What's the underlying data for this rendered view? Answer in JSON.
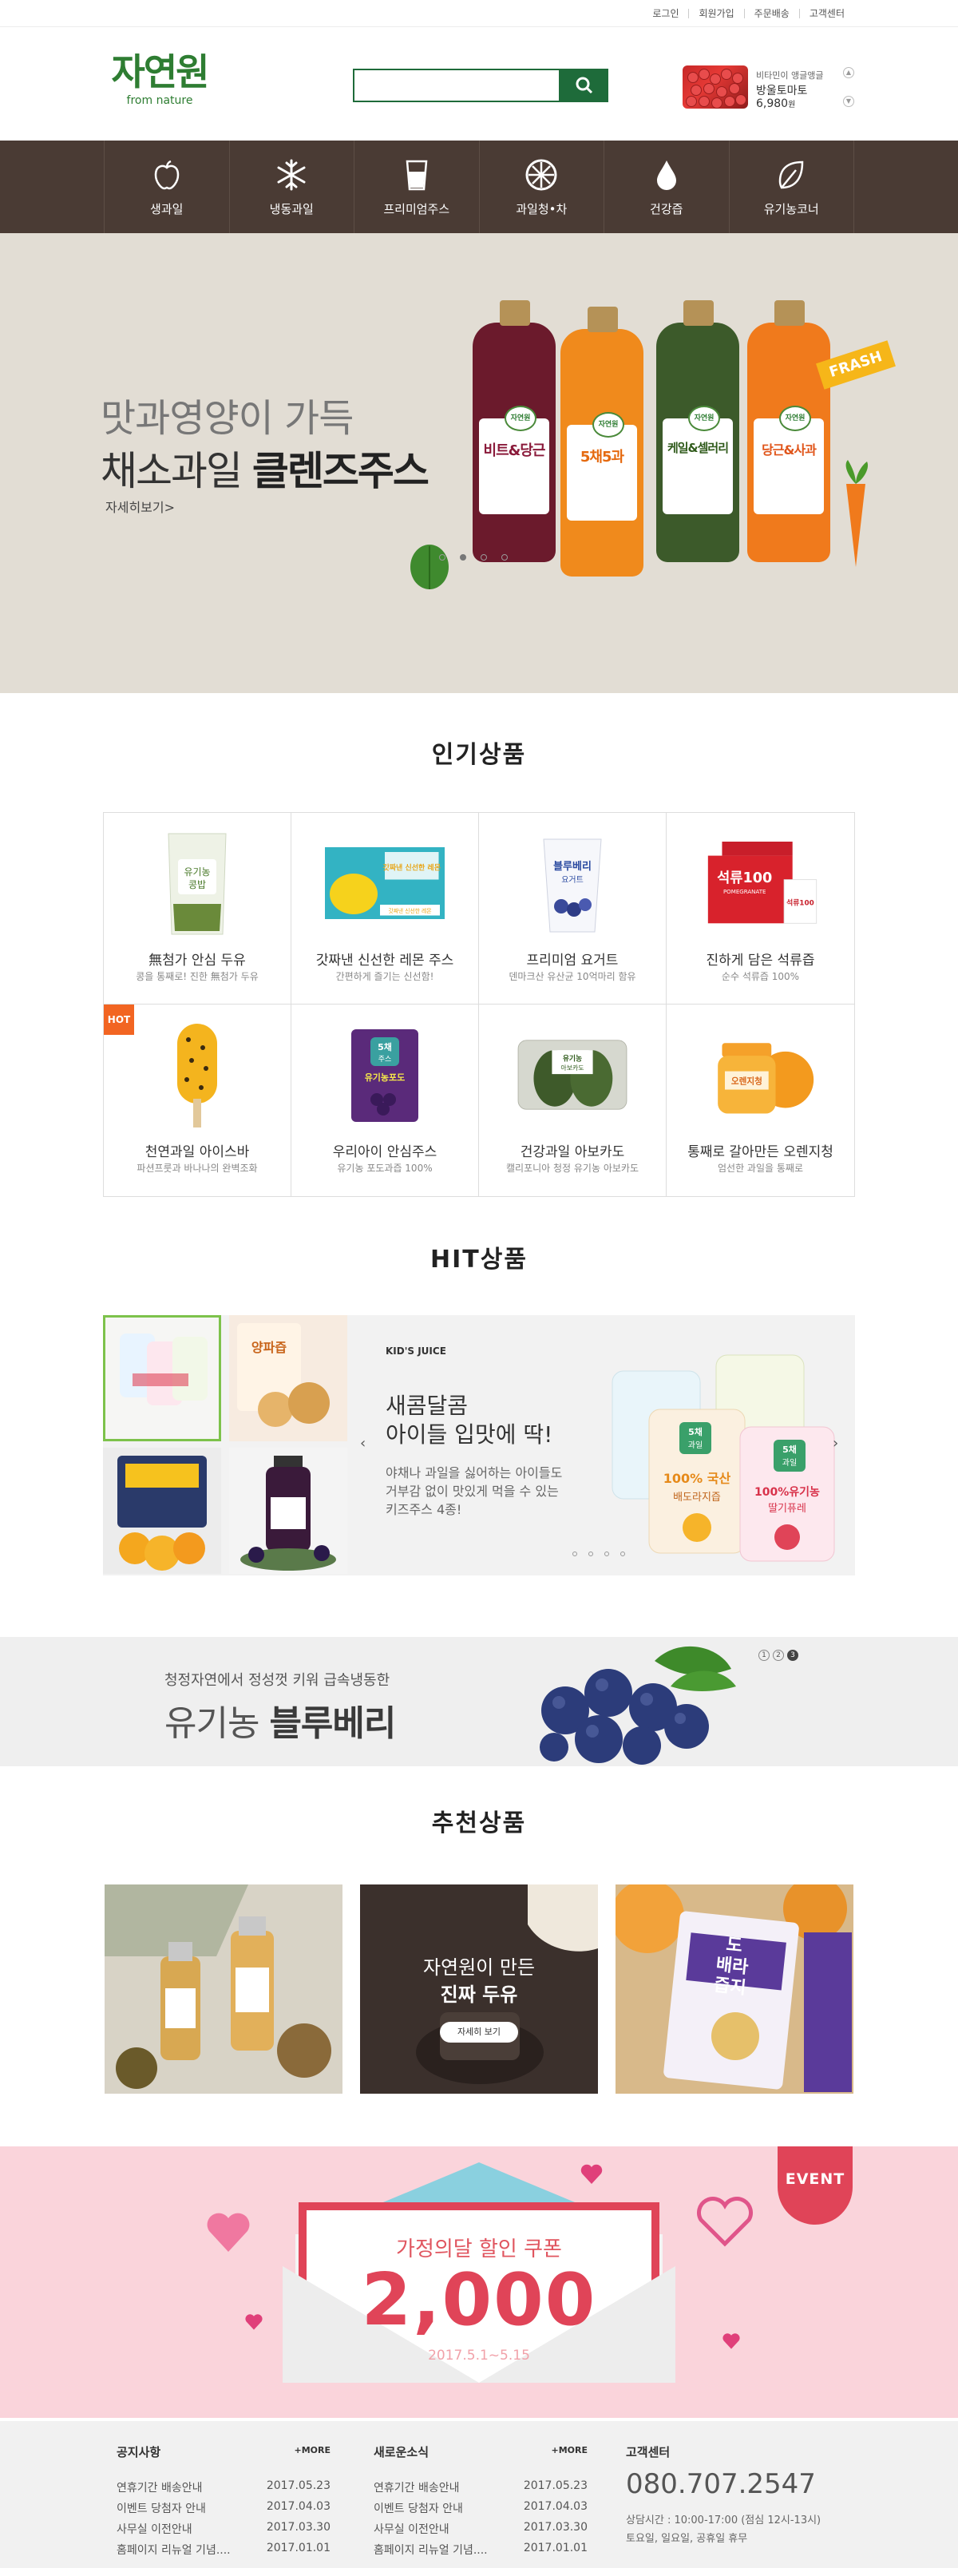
{
  "topbar": {
    "links": [
      "로그인",
      "회원가입",
      "주문배송",
      "고객센터"
    ]
  },
  "header": {
    "logo_ko": "자연원",
    "logo_en": "from nature",
    "search": {
      "value": "",
      "placeholder": ""
    },
    "promo": {
      "sub": "비타민이 앵글앵글",
      "name": "방울토마토",
      "price": "6,980",
      "unit": "원"
    }
  },
  "nav": [
    {
      "label": "생과일",
      "icon": "apple-icon"
    },
    {
      "label": "냉동과일",
      "icon": "snowflake-icon"
    },
    {
      "label": "프리미엄주스",
      "icon": "glass-icon"
    },
    {
      "label": "과일청•차",
      "icon": "citrus-slice-icon"
    },
    {
      "label": "건강즙",
      "icon": "drop-icon"
    },
    {
      "label": "유기농코너",
      "icon": "leaf-icon"
    }
  ],
  "hero": {
    "line1": "맛과영양이 가득",
    "line2_normal": "채소과일 ",
    "line2_bold": "클렌즈주스",
    "more": "자세히보기>",
    "badge": "FRASH",
    "bottles": [
      {
        "brand": "자연원",
        "name": "비트&당근",
        "color": "#6b1a2c"
      },
      {
        "brand": "자연원",
        "name": "5채5과",
        "color": "#f08a1c"
      },
      {
        "brand": "자연원",
        "name": "케일&셀러리",
        "color": "#3c5a2a"
      },
      {
        "brand": "자연원",
        "name": "당근&사과",
        "color": "#f07a1c"
      }
    ],
    "slides": 4,
    "active_slide": 2
  },
  "popular": {
    "title": "인기상품",
    "items": [
      {
        "name": "無첨가 안심 두유",
        "desc": "콩을 통째로! 진한 無첨가 두유",
        "badge": ""
      },
      {
        "name": "갓짜낸 신선한 레몬 주스",
        "desc": "간편하게 즐기는 신선함!",
        "badge": ""
      },
      {
        "name": "프리미엄 요거트",
        "desc": "덴마크산 유산균 10억마리 함유",
        "badge": ""
      },
      {
        "name": "진하게 담은 석류즙",
        "desc": "순수 석류즙 100%",
        "badge": ""
      },
      {
        "name": "천연과일 아이스바",
        "desc": "파션프룻과 바나나의 완벽조화",
        "badge": "HOT"
      },
      {
        "name": "우리아이 안심주스",
        "desc": "유기농 포도과즙 100%",
        "badge": ""
      },
      {
        "name": "건강과일 아보카도",
        "desc": "캘리포니아 청정 유기농 아보카도",
        "badge": ""
      },
      {
        "name": "통째로 갈아만든 오렌지청",
        "desc": "엄선한 과일을 통째로",
        "badge": ""
      }
    ],
    "labels": {
      "soy": [
        "유기농",
        "콩밥"
      ],
      "lemon_top": "갓짜낸 신선한 레몬",
      "lemon_bottom": "갓짜낸 신선한 레몬",
      "yogurt": [
        "블루베리",
        "요거트"
      ],
      "pome": "석류100",
      "pome_sub": "POMEGRANATE",
      "grape": [
        "5채",
        "주스",
        "유기농포도"
      ],
      "avo": [
        "유기농",
        "아보카도"
      ],
      "jam": "오렌지청"
    }
  },
  "hit": {
    "title": "HIT상품",
    "category": "KID'S JUICE",
    "headline": [
      "새콤달콤",
      "아이들 입맛에 딱!"
    ],
    "desc": [
      "야채나 과일을 싫어하는 아이들도",
      "거부감 없이 맛있게 먹을 수 있는",
      "키즈주스 4종!"
    ],
    "pouches": [
      {
        "top": "5채",
        "mid": "과일",
        "label": "100% 국산",
        "sub": "배도라지즙"
      },
      {
        "top": "5채",
        "mid": "과일",
        "label": "100%유기농",
        "sub": "딸기퓨레"
      }
    ],
    "onion_label": "양파즙",
    "slides": 4,
    "active_slide": 1
  },
  "berry": {
    "sub": "청정자연에서 정성껏 키워 급속냉동한",
    "title_normal": "유기농 ",
    "title_bold": "블루베리",
    "pages": [
      "1",
      "2",
      "3"
    ],
    "active_page": 3
  },
  "recommend": {
    "title": "추천상품",
    "center_line1": "자연원이 만든",
    "center_line2": "진짜 두유",
    "center_button": "자세히 보기",
    "right_label": [
      "도",
      "배",
      "라",
      "즙",
      "지"
    ]
  },
  "event": {
    "badge": "EVENT",
    "title": "가정의달 할인 쿠폰",
    "amount": "2,000",
    "date": "2017.5.1~5.15"
  },
  "footer": {
    "notice": {
      "title": "공지사항",
      "more": "+MORE",
      "items": [
        {
          "t": "연휴기간 배송안내",
          "d": "2017.05.23"
        },
        {
          "t": "이벤트 당첨자 안내",
          "d": "2017.04.03"
        },
        {
          "t": "사무실 이전안내",
          "d": "2017.03.30"
        },
        {
          "t": "홈페이지 리뉴얼 기념....",
          "d": "2017.01.01"
        }
      ]
    },
    "news": {
      "title": "새로운소식",
      "more": "+MORE",
      "items": [
        {
          "t": "연휴기간 배송안내",
          "d": "2017.05.23"
        },
        {
          "t": "이벤트 당첨자 안내",
          "d": "2017.04.03"
        },
        {
          "t": "사무실 이전안내",
          "d": "2017.03.30"
        },
        {
          "t": "홈페이지 리뉴얼 기념....",
          "d": "2017.01.01"
        }
      ]
    },
    "cs": {
      "title": "고객센터",
      "tel": "080.707.2547",
      "hours1": "상담시간 : 10:00-17:00 (점심 12시-13시)",
      "hours2": "토요일, 일요일, 공휴일 휴무"
    }
  },
  "colors": {
    "brand_green": "#1e6b3a",
    "nav_brown": "#4a3b34",
    "hero_bg": "#e2ddd4",
    "hot": "#f26522",
    "event_pink": "#fad4db",
    "event_red": "#e04458"
  }
}
